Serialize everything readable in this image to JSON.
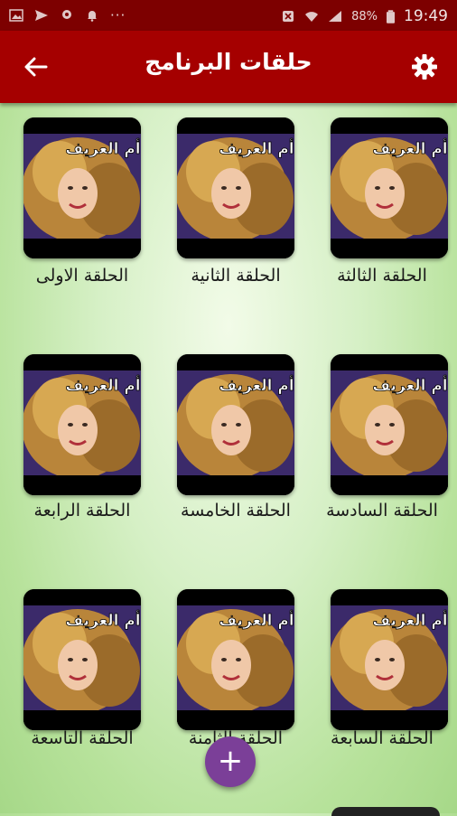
{
  "status_bar": {
    "time": "19:49",
    "battery": "88%"
  },
  "app_bar": {
    "title": "حلقات البرنامج"
  },
  "thumbnail": {
    "caption": "أم العريف"
  },
  "episodes": [
    {
      "label": "الحلقة الثالثة"
    },
    {
      "label": "الحلقة الثانية"
    },
    {
      "label": "الحلقة الاولى"
    },
    {
      "label": "الحلقة السادسة"
    },
    {
      "label": "الحلقة الخامسة"
    },
    {
      "label": "الحلقة الرابعة"
    },
    {
      "label": "الحلقة السابعة"
    },
    {
      "label": "الحلقة الثامنة"
    },
    {
      "label": "الحلقة التاسعة"
    }
  ],
  "fab": {
    "symbol": "+"
  },
  "colors": {
    "status_bar": "#7d0000",
    "app_bar": "#a50000",
    "fab": "#7b3f98",
    "background": "#c4e8ad"
  }
}
